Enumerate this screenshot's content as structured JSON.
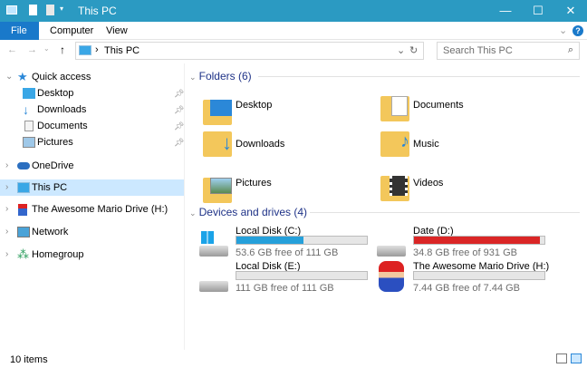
{
  "window": {
    "title": "This PC",
    "minimize": "—",
    "maximize": "☐",
    "close": "✕"
  },
  "ribbon": {
    "tabs": [
      "File",
      "Computer",
      "View"
    ],
    "help": "?",
    "expand": "⌄"
  },
  "nav": {
    "back": "←",
    "forward": "→",
    "recent": "⌄",
    "up": "↑",
    "breadcrumb_sep": "›",
    "location": "This PC",
    "dropdown": "⌄",
    "refresh": "↻"
  },
  "search": {
    "placeholder": "Search This PC",
    "icon": "⌕"
  },
  "sidebar": {
    "items": [
      {
        "label": "Quick access",
        "icon": "star-icon"
      },
      {
        "label": "Desktop",
        "icon": "desktop-icon",
        "pinned": true
      },
      {
        "label": "Downloads",
        "icon": "download-icon",
        "pinned": true
      },
      {
        "label": "Documents",
        "icon": "documents-icon",
        "pinned": true
      },
      {
        "label": "Pictures",
        "icon": "pictures-icon",
        "pinned": true
      },
      {
        "label": "OneDrive",
        "icon": "cloud-icon"
      },
      {
        "label": "This PC",
        "icon": "computer-icon",
        "selected": true
      },
      {
        "label": "The Awesome Mario Drive (H:)",
        "icon": "mario-icon"
      },
      {
        "label": "Network",
        "icon": "network-icon"
      },
      {
        "label": "Homegroup",
        "icon": "homegroup-icon"
      }
    ]
  },
  "folders": {
    "header": "Folders (6)",
    "items": [
      "Desktop",
      "Documents",
      "Downloads",
      "Music",
      "Pictures",
      "Videos"
    ]
  },
  "drives": {
    "header": "Devices and drives (4)",
    "items": [
      {
        "name": "Local Disk (C:)",
        "free": "53.6 GB free of 111 GB",
        "used_fraction": 0.517,
        "color": "#26a0da"
      },
      {
        "name": "Date (D:)",
        "free": "34.8 GB free of 931 GB",
        "used_fraction": 0.963,
        "color": "#da2626"
      },
      {
        "name": "Local Disk (E:)",
        "free": "111 GB free of 111 GB",
        "used_fraction": 0,
        "color": "#26a0da"
      },
      {
        "name": "The Awesome Mario Drive (H:)",
        "free": "7.44 GB free of 7.44 GB",
        "used_fraction": 0,
        "color": "#26a0da"
      }
    ]
  },
  "status": {
    "count": "10 items"
  }
}
